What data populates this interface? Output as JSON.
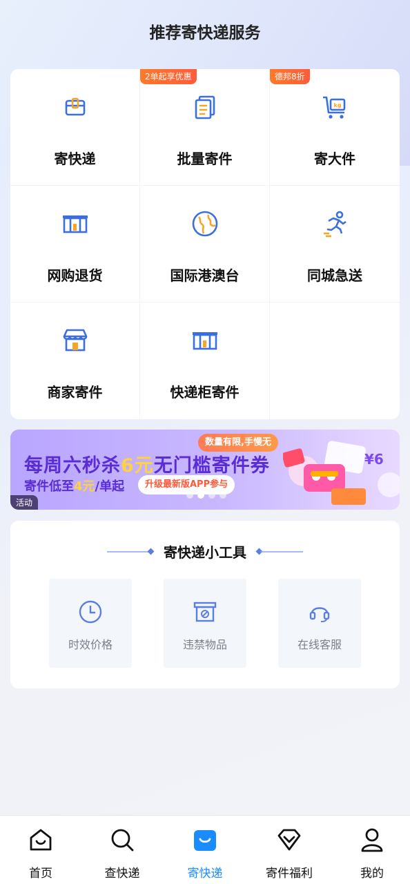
{
  "header": {
    "title": "推荐寄快递服务"
  },
  "services": [
    {
      "label": "寄快递",
      "icon": "box-icon"
    },
    {
      "label": "批量寄件",
      "icon": "documents-icon",
      "badge": "2单起享优惠"
    },
    {
      "label": "寄大件",
      "icon": "cart-kg-icon",
      "badge": "德邦8折"
    },
    {
      "label": "网购退货",
      "icon": "locker-icon"
    },
    {
      "label": "国际港澳台",
      "icon": "globe-icon"
    },
    {
      "label": "同城急送",
      "icon": "runner-icon"
    },
    {
      "label": "商家寄件",
      "icon": "store-icon"
    },
    {
      "label": "快递柜寄件",
      "icon": "locker-icon"
    }
  ],
  "banner": {
    "line1_pre": "每周六秒杀",
    "line1_hl": "6元",
    "line1_post": "无门槛寄件券",
    "line2_pre": "寄件低至",
    "line2_hl": "4元",
    "line2_post": "/单起",
    "pill_top": "数量有限,手慢无",
    "pill_cta": "升级最新版APP参与",
    "tag": "活动",
    "deco_text": "¥6",
    "dots_total": 4,
    "dots_active": 2
  },
  "tools": {
    "title": "寄快递小工具",
    "items": [
      {
        "label": "时效价格",
        "icon": "clock-icon"
      },
      {
        "label": "违禁物品",
        "icon": "prohibited-box-icon"
      },
      {
        "label": "在线客服",
        "icon": "headset-icon"
      }
    ]
  },
  "tabbar": {
    "items": [
      {
        "label": "首页",
        "icon": "home-icon"
      },
      {
        "label": "查快递",
        "icon": "search-icon"
      },
      {
        "label": "寄快递",
        "icon": "send-package-icon",
        "active": true
      },
      {
        "label": "寄件福利",
        "icon": "diamond-icon"
      },
      {
        "label": "我的",
        "icon": "user-icon"
      }
    ]
  },
  "colors": {
    "accent": "#1a8cff",
    "icon_blue": "#3b6fe0",
    "icon_orange": "#f5a623",
    "badge_orange": "#ff6a35",
    "banner_purple": "#5a2cd6"
  }
}
